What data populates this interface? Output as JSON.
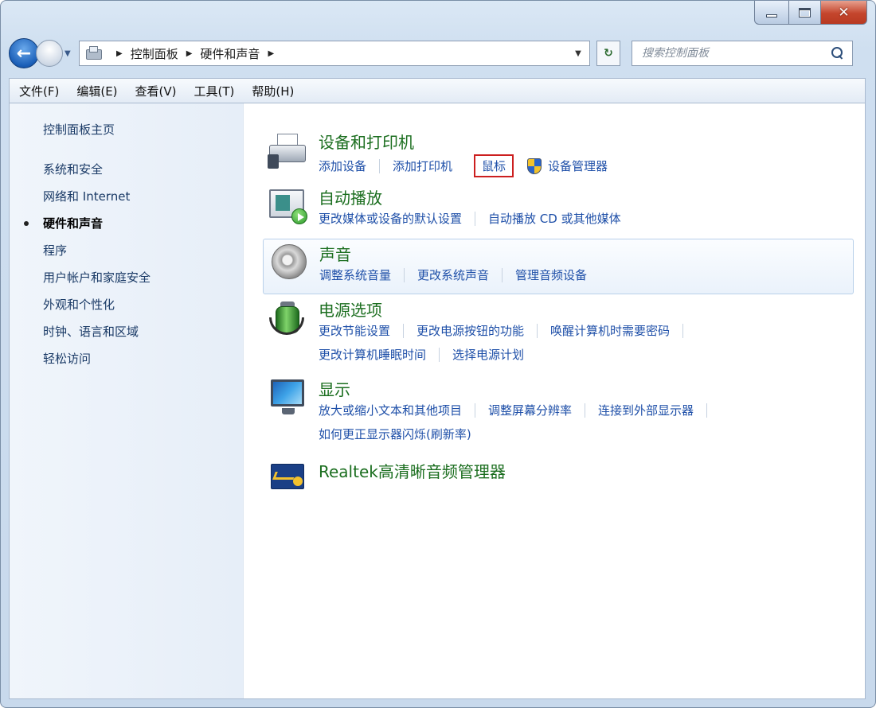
{
  "nav": {
    "breadcrumb": [
      "控制面板",
      "硬件和声音"
    ],
    "search_placeholder": "搜索控制面板"
  },
  "menu": [
    "文件(F)",
    "编辑(E)",
    "查看(V)",
    "工具(T)",
    "帮助(H)"
  ],
  "sidebar": {
    "home": "控制面板主页",
    "items": [
      {
        "label": "系统和安全"
      },
      {
        "label": "网络和 Internet"
      },
      {
        "label": "硬件和声音",
        "active": true
      },
      {
        "label": "程序"
      },
      {
        "label": "用户帐户和家庭安全"
      },
      {
        "label": "外观和个性化"
      },
      {
        "label": "时钟、语言和区域"
      },
      {
        "label": "轻松访问"
      }
    ]
  },
  "categories": {
    "devices": {
      "title": "设备和打印机",
      "links": [
        "添加设备",
        "添加打印机",
        "鼠标",
        "设备管理器"
      ]
    },
    "autoplay": {
      "title": "自动播放",
      "links": [
        "更改媒体或设备的默认设置",
        "自动播放 CD 或其他媒体"
      ]
    },
    "sound": {
      "title": "声音",
      "links": [
        "调整系统音量",
        "更改系统声音",
        "管理音频设备"
      ]
    },
    "power": {
      "title": "电源选项",
      "links": [
        "更改节能设置",
        "更改电源按钮的功能",
        "唤醒计算机时需要密码",
        "更改计算机睡眠时间",
        "选择电源计划"
      ]
    },
    "display": {
      "title": "显示",
      "links": [
        "放大或缩小文本和其他项目",
        "调整屏幕分辨率",
        "连接到外部显示器",
        "如何更正显示器闪烁(刷新率)"
      ]
    },
    "realtek": {
      "title": "Realtek高清晰音频管理器"
    }
  },
  "colors": {
    "category_title": "#1b6e1f",
    "link": "#1e4fa8",
    "highlight_box": "#cc1f1f"
  }
}
